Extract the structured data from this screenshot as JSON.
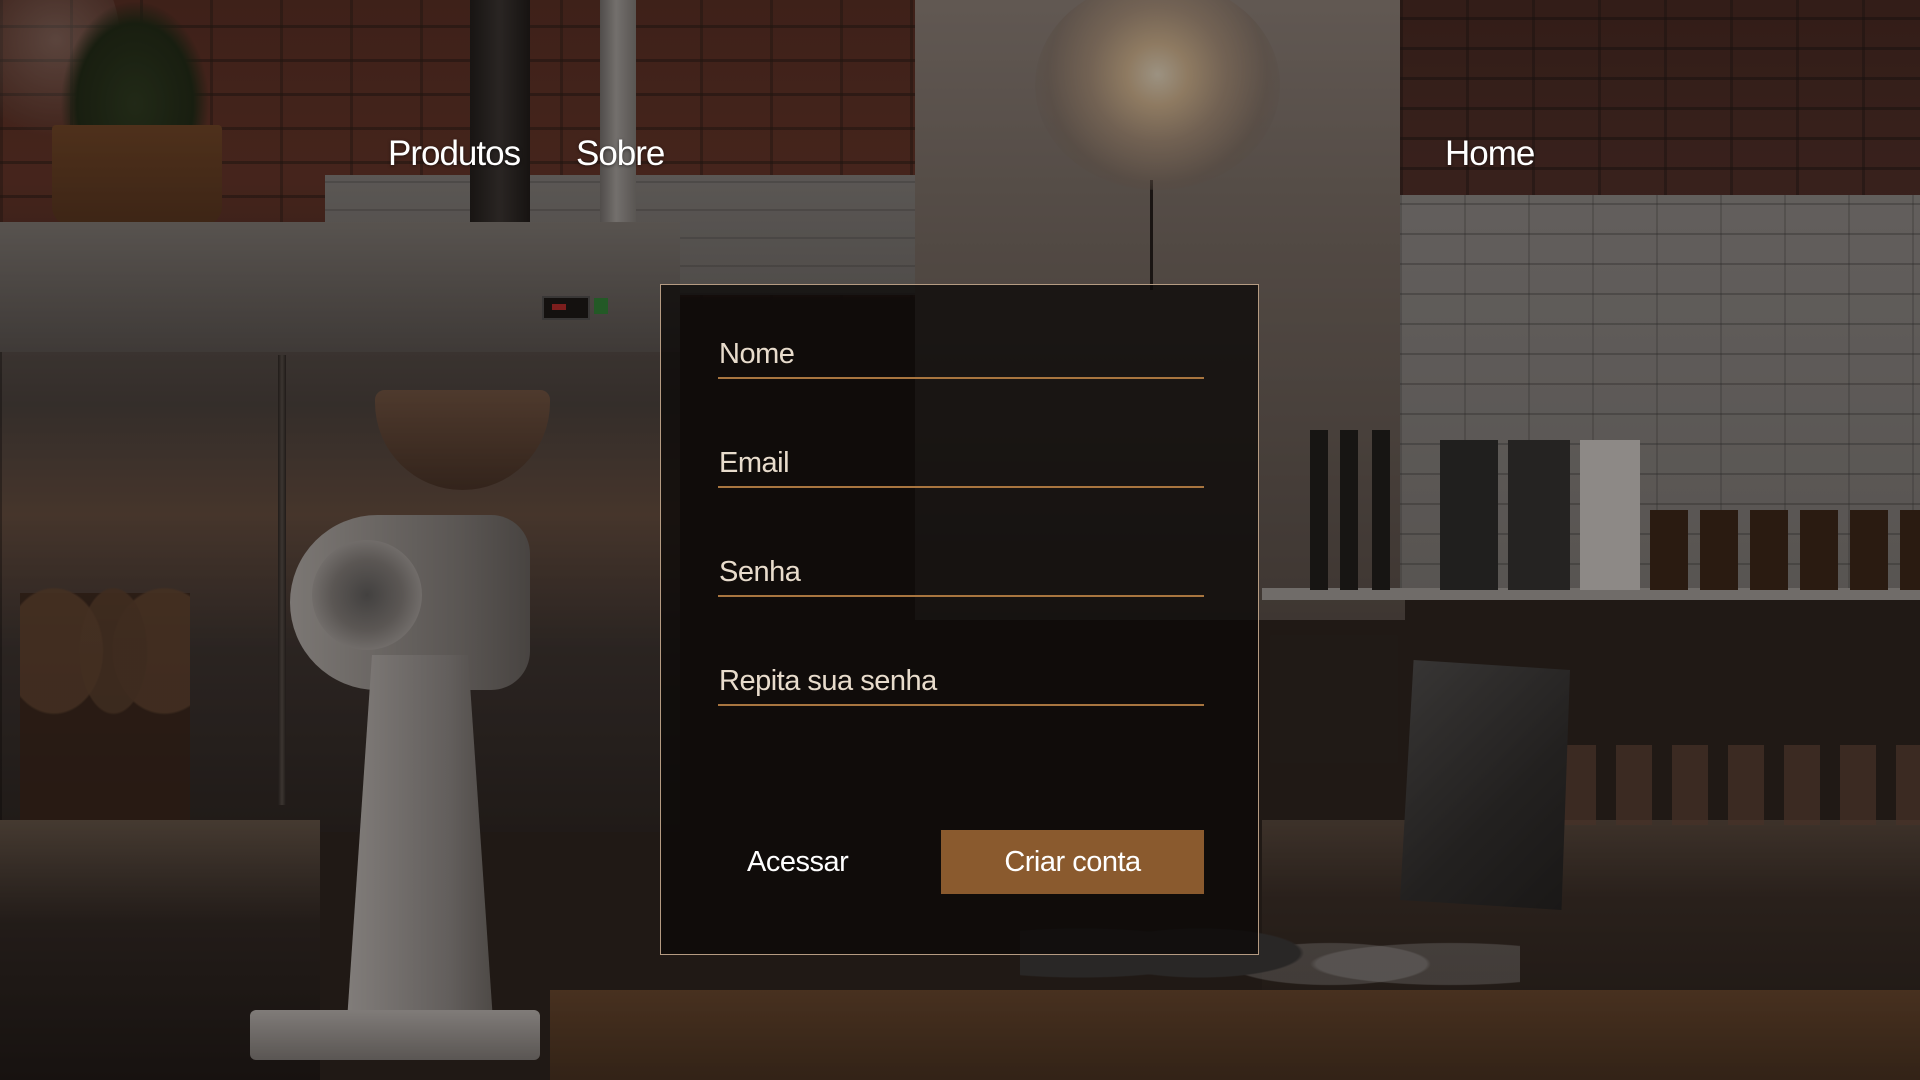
{
  "nav": {
    "produtos": "Produtos",
    "sobre": "Sobre",
    "home": "Home"
  },
  "form": {
    "fields": [
      {
        "label": "Nome",
        "value": ""
      },
      {
        "label": "Email",
        "value": ""
      },
      {
        "label": "Senha",
        "value": ""
      },
      {
        "label": "Repita sua senha",
        "value": ""
      }
    ],
    "secondary_button": "Acessar",
    "primary_button": "Criar conta"
  },
  "colors": {
    "accent": "#8a5a2e",
    "field_underline": "#a8753f",
    "panel_border": "#b59b82"
  }
}
